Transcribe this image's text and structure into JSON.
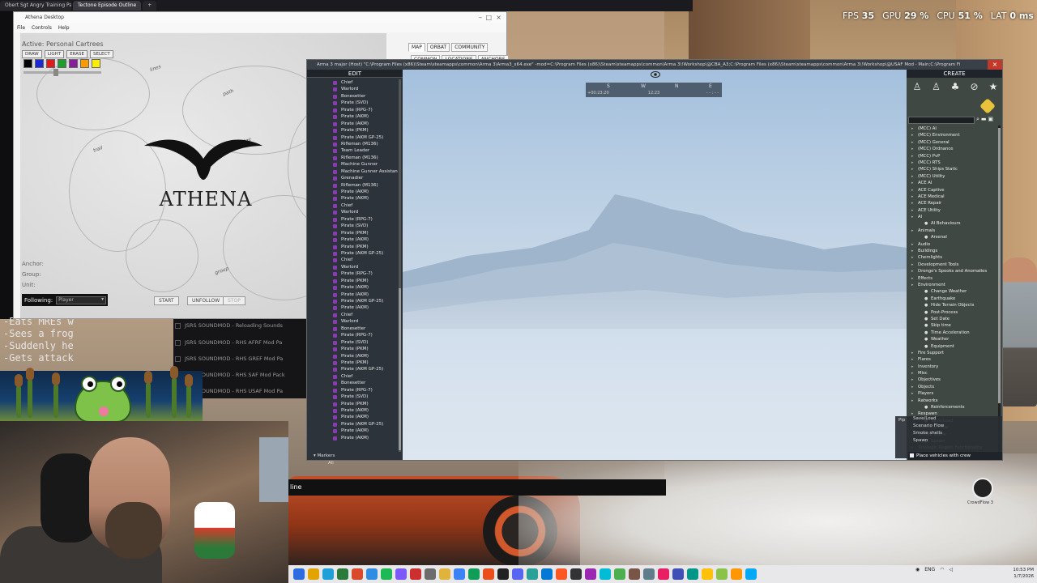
{
  "browser": {
    "tabs": [
      "Obert Sgt Angry Training Pal Pa",
      "Tectone Episode Outline"
    ]
  },
  "overlay": {
    "fps_label": "FPS",
    "fps_value": "35",
    "gpu_label": "GPU",
    "gpu_value": "29 %",
    "cpu_label": "CPU",
    "cpu_value": "51 %",
    "lat_label": "LAT",
    "lat_value": "0 ms"
  },
  "left_text": {
    "lines": [
      "-Eats MREs w",
      "-Sees a frog",
      "-Suddenly he",
      "-Gets attack"
    ]
  },
  "athena": {
    "title": "Athena Desktop",
    "menu": [
      "File",
      "Controls",
      "Help"
    ],
    "active_label": "Active: Personal Cartrees",
    "tools": [
      "DRAW",
      "LIGHT",
      "ERASE",
      "SELECT"
    ],
    "swatch_colors": [
      "#000000",
      "#1a2bd6",
      "#e01b1b",
      "#1e9e2a",
      "#8a1c9e",
      "#ff9a00",
      "#ffee00"
    ],
    "logo_text": "ATHENA",
    "anchor_label": "Anchor:",
    "group_label": "Group:",
    "unit_label": "Unit:",
    "following_label": "Following:",
    "following_value": "Player",
    "start": "START",
    "unfollow": "UNFOLLOW",
    "stop": "STOP",
    "tabs": [
      "MAP",
      "ORBAT",
      "COMMUNITY"
    ],
    "subtabs": [
      "COMMON",
      "LOCATIONS",
      "ANCHORS"
    ]
  },
  "tasks": [
    "JSRS SOUNDMOD - Reloading Sounds",
    "JSRS SOUNDMOD - RHS AFRF Mod Pa",
    "JSRS SOUNDMOD - RHS GREF Mod Pa",
    "JSRS SOUNDMOD - RHS SAF Mod Pack",
    "JSRS SOUNDMOD - RHS USAF Mod Pa"
  ],
  "dark_strip_text": "line",
  "arma": {
    "title": "Arma 3 major (Host) \"C:\\Program Files (x86)\\Steam\\steamapps\\common\\Arma 3\\Arma3_x64.exe\" -mod=C:\\Program Files (x86)\\Steam\\steamapps\\common\\Arma 3\\!Workshop\\@CBA_A3;C:\\Program Files (x86)\\Steam\\steamapps\\common\\Arma 3\\!Workshop\\@USAF Mod - Main;C:\\Program Fi",
    "compass": {
      "s": "S",
      "w": "W",
      "n": "N",
      "e": "E",
      "elapsed": "+00:23:20",
      "time": "12:23",
      "dash": "- - : - -"
    },
    "edit_header": "EDIT",
    "create_header": "CREATE",
    "units": [
      "Chief",
      "Warlord",
      "Bonesetter",
      "Pirate (SVD)",
      "Pirate (RPG-7)",
      "Pirate (AKM)",
      "Pirate (AKM)",
      "Pirate (PKM)",
      "Pirate (AKM GP-25)",
      "Rifleman (M136)",
      "Team Leader",
      "Rifleman (M136)",
      "Machine Gunner",
      "Machine Gunner Assistant",
      "Grenadier",
      "Rifleman (M136)",
      "Pirate (AKM)",
      "Pirate (AKM)",
      "Chief",
      "Warlord",
      "Pirate (RPG-7)",
      "Pirate (SVD)",
      "Pirate (PKM)",
      "Pirate (AKM)",
      "Pirate (PKM)",
      "Pirate (AKM GP-25)",
      "Chief",
      "Warlord",
      "Pirate (RPG-7)",
      "Pirate (PKM)",
      "Pirate (AKM)",
      "Pirate (AKM)",
      "Pirate (AKM GP-25)",
      "Pirate (AKM)",
      "Chief",
      "Warlord",
      "Bonesetter",
      "Pirate (RPG-7)",
      "Pirate (SVD)",
      "Pirate (PKM)",
      "Pirate (AKM)",
      "Pirate (PKM)",
      "Pirate (AKM GP-25)",
      "Chief",
      "Bonesetter",
      "Pirate (RPG-7)",
      "Pirate (SVD)",
      "Pirate (PKM)",
      "Pirate (AKM)",
      "Pirate (AKM)",
      "Pirate (AKM GP-25)",
      "Pirate (AKM)",
      "Pirate (AKM)"
    ],
    "markers": "Markers",
    "all": "All",
    "categories": [
      {
        "t": "(MCC) AI",
        "l": 0
      },
      {
        "t": "(MCC) Environment",
        "l": 0
      },
      {
        "t": "(MCC) General",
        "l": 0
      },
      {
        "t": "(MCC) Ordnance",
        "l": 0
      },
      {
        "t": "(MCC) PvP",
        "l": 0
      },
      {
        "t": "(MCC) RTS",
        "l": 0
      },
      {
        "t": "(MCC) Ships Static",
        "l": 0
      },
      {
        "t": "(MCC) Utility",
        "l": 0
      },
      {
        "t": "ACE AI",
        "l": 0
      },
      {
        "t": "ACE Captive",
        "l": 0
      },
      {
        "t": "ACE Medical",
        "l": 0
      },
      {
        "t": "ACE Repair",
        "l": 0
      },
      {
        "t": "ACE Utility",
        "l": 0
      },
      {
        "t": "AI",
        "l": 0
      },
      {
        "t": "AI Behaviours",
        "l": 1
      },
      {
        "t": "Animals",
        "l": 0
      },
      {
        "t": "Arsenal",
        "l": 1
      },
      {
        "t": "Audio",
        "l": 0
      },
      {
        "t": "Buildings",
        "l": 0
      },
      {
        "t": "Chemlights",
        "l": 0
      },
      {
        "t": "Development Tools",
        "l": 0
      },
      {
        "t": "Drongo's Spooks and Anomalies",
        "l": 0
      },
      {
        "t": "Effects",
        "l": 0
      },
      {
        "t": "Environment",
        "l": 0
      },
      {
        "t": "Change Weather",
        "l": 1
      },
      {
        "t": "Earthquake",
        "l": 1
      },
      {
        "t": "Hide Terrain Objects",
        "l": 1
      },
      {
        "t": "Post-Process",
        "l": 1
      },
      {
        "t": "Set Date",
        "l": 1
      },
      {
        "t": "Skip time",
        "l": 1
      },
      {
        "t": "Time Acceleration",
        "l": 1
      },
      {
        "t": "Weather",
        "l": 1
      },
      {
        "t": "Equipment",
        "l": 1
      },
      {
        "t": "Fire Support",
        "l": 0
      },
      {
        "t": "Flares",
        "l": 0
      },
      {
        "t": "Inventory",
        "l": 0
      },
      {
        "t": "Misc",
        "l": 0
      },
      {
        "t": "Objectives",
        "l": 0
      },
      {
        "t": "Objects",
        "l": 0
      },
      {
        "t": "Players",
        "l": 0
      },
      {
        "t": "Ratworks",
        "l": 0
      },
      {
        "t": "Reinforcements",
        "l": 1
      },
      {
        "t": "Respawn",
        "l": 0
      },
      {
        "t": "Save/Load",
        "l": 1
      },
      {
        "t": "Scenario Flow",
        "l": 0
      },
      {
        "t": "Smoke shells",
        "l": 0
      },
      {
        "t": "Spawn",
        "l": 1
      },
      {
        "t": "Strategic Region Functionality",
        "l": 0
      }
    ],
    "place_crew": "Place vehicles with crew",
    "pip_label": "Pip",
    "pip_items": [
      "Save/Load",
      "Scenario Flow",
      "Smoke shells",
      "Spawn"
    ]
  },
  "taskbar": {
    "icon_colors": [
      "#2d6be0",
      "#e2a400",
      "#1fa0d8",
      "#2c7a3a",
      "#d84a2a",
      "#2f8ce0",
      "#1db954",
      "#7a5af8",
      "#cc2f2f",
      "#6c6c6c",
      "#e0b43a",
      "#3b82f6",
      "#0f9d58",
      "#e94e1b",
      "#222222",
      "#5865f2",
      "#2aa198",
      "#0078d4",
      "#ff5722",
      "#333333",
      "#9c27b0",
      "#00bcd4",
      "#4caf50",
      "#795548",
      "#607d8b",
      "#e91e63",
      "#3f51b5",
      "#009688",
      "#ffc107",
      "#8bc34a",
      "#ff9800",
      "#03a9f4"
    ],
    "tray_lang": "ENG",
    "time": "10:53 PM",
    "date": "1/7/2026"
  },
  "obs_label": "CrowdFlow 3"
}
